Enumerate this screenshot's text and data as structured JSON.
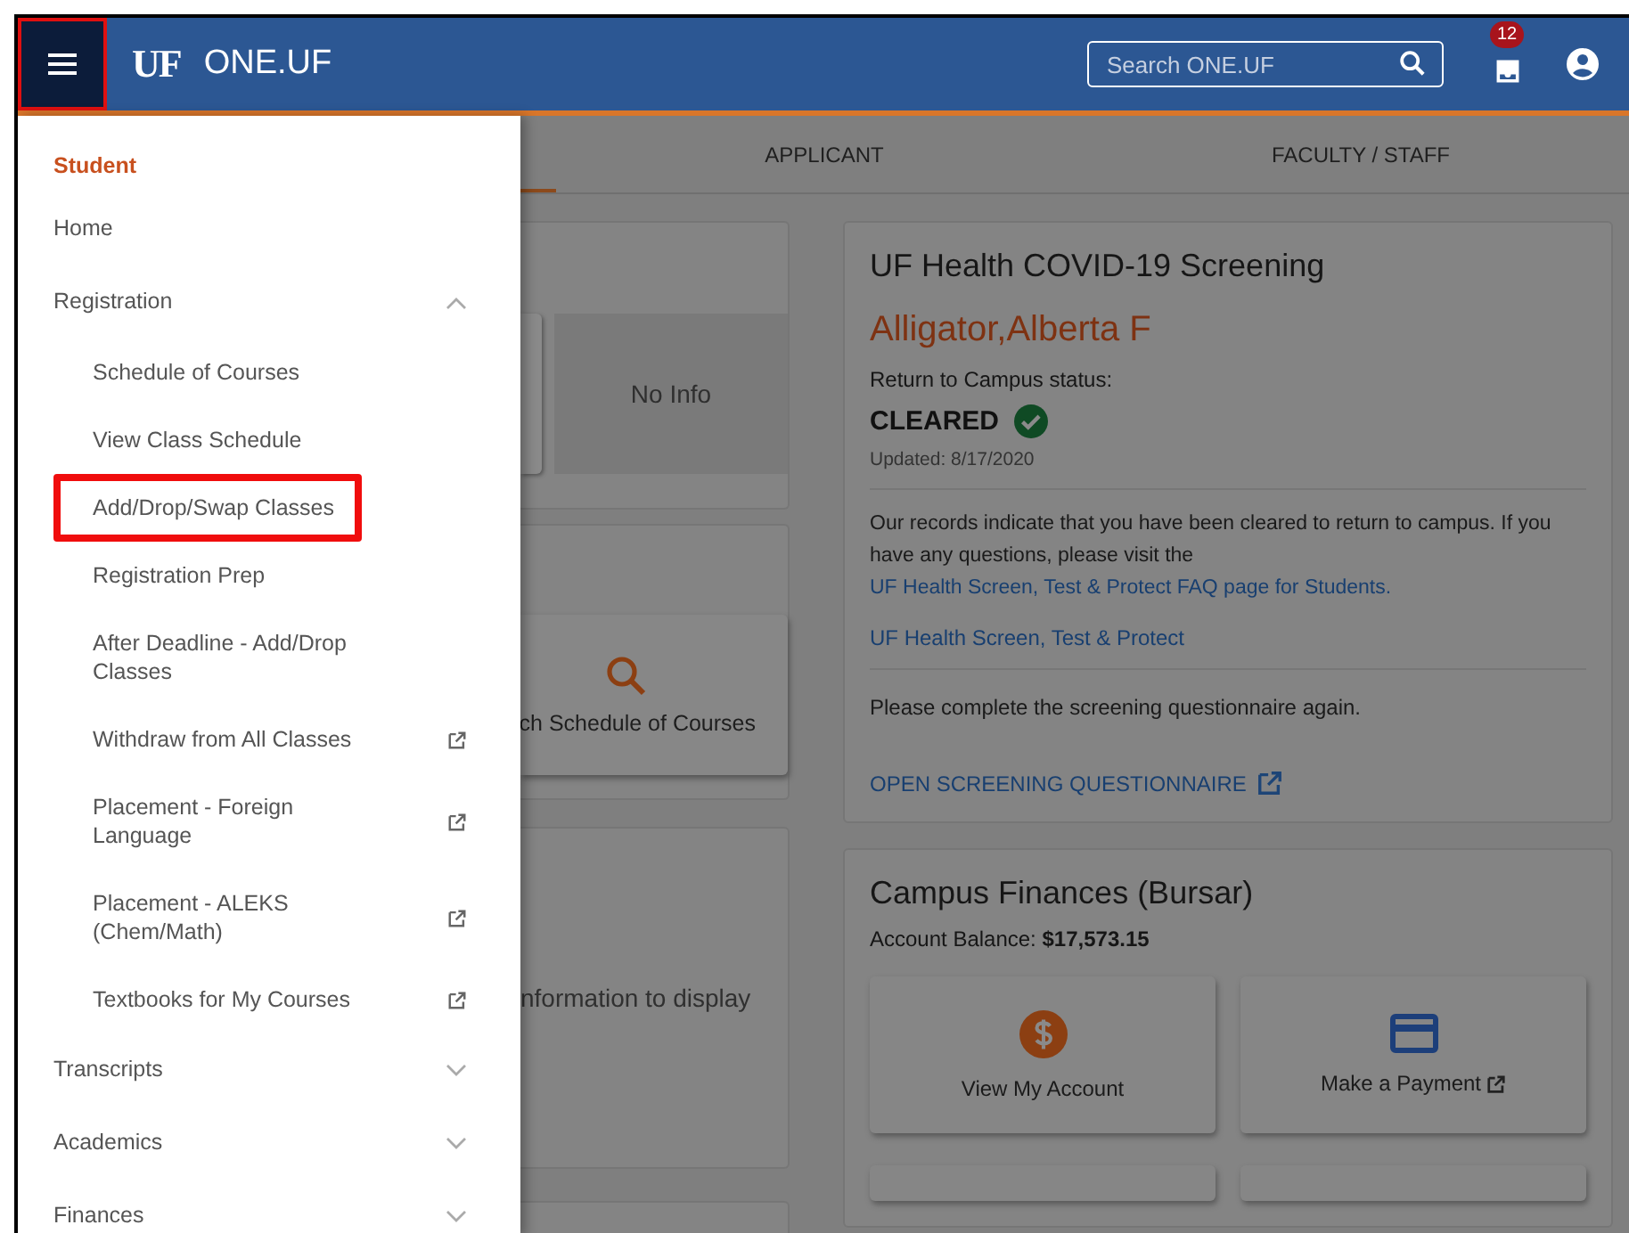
{
  "header": {
    "menu_highlighted": true,
    "logo": "UF",
    "title": "ONE.UF",
    "search": {
      "placeholder": "Search ONE.UF"
    },
    "notifications_badge": "12"
  },
  "tabs": [
    {
      "label": "APPLICANT",
      "selected": false
    },
    {
      "label": "FACULTY / STAFF",
      "selected": false
    }
  ],
  "drawer": {
    "section": "Student",
    "items": [
      {
        "label": "Home",
        "kind": "link"
      },
      {
        "label": "Registration",
        "kind": "group",
        "expanded": true,
        "children": [
          {
            "label": "Schedule of Courses",
            "external": false,
            "highlighted": false
          },
          {
            "label": "View Class Schedule",
            "external": false,
            "highlighted": false
          },
          {
            "label": "Add/Drop/Swap Classes",
            "external": false,
            "highlighted": true
          },
          {
            "label": "Registration Prep",
            "external": false,
            "highlighted": false
          },
          {
            "label": "After Deadline - Add/Drop Classes",
            "external": false,
            "highlighted": false
          },
          {
            "label": "Withdraw from All Classes",
            "external": true,
            "highlighted": false
          },
          {
            "label": "Placement - Foreign Language",
            "external": true,
            "highlighted": false
          },
          {
            "label": "Placement - ALEKS (Chem/Math)",
            "external": true,
            "highlighted": false
          },
          {
            "label": "Textbooks for My Courses",
            "external": true,
            "highlighted": false
          }
        ]
      },
      {
        "label": "Transcripts",
        "kind": "group",
        "expanded": false
      },
      {
        "label": "Academics",
        "kind": "group",
        "expanded": false
      },
      {
        "label": "Finances",
        "kind": "group",
        "expanded": false
      }
    ]
  },
  "left_cards": [
    {
      "kind": "tiles",
      "text": "No Info"
    },
    {
      "kind": "action",
      "text": "ch Schedule of Courses"
    },
    {
      "kind": "message",
      "text": "nformation to display"
    },
    {
      "kind": "empty"
    }
  ],
  "covid": {
    "title": "UF Health COVID-19 Screening",
    "name": "Alligator,Alberta F",
    "status_label": "Return to Campus status:",
    "status": "CLEARED",
    "cleared": true,
    "updated": "Updated: 8/17/2020",
    "message": "Our records indicate that you have been cleared to return to campus. If you have any questions, please visit the",
    "message_link": "UF Health Screen, Test & Protect FAQ page for Students.",
    "link": "UF Health Screen, Test & Protect",
    "note": "Please complete the screening questionnaire again.",
    "action": "OPEN SCREENING QUESTIONNAIRE"
  },
  "bursar": {
    "title": "Campus Finances (Bursar)",
    "balance_label": "Account Balance:",
    "balance": "$17,573.15",
    "tiles": [
      {
        "kind": "dollar",
        "label": "View My Account",
        "external": false
      },
      {
        "kind": "card",
        "label": "Make a Payment",
        "external": true
      }
    ]
  }
}
